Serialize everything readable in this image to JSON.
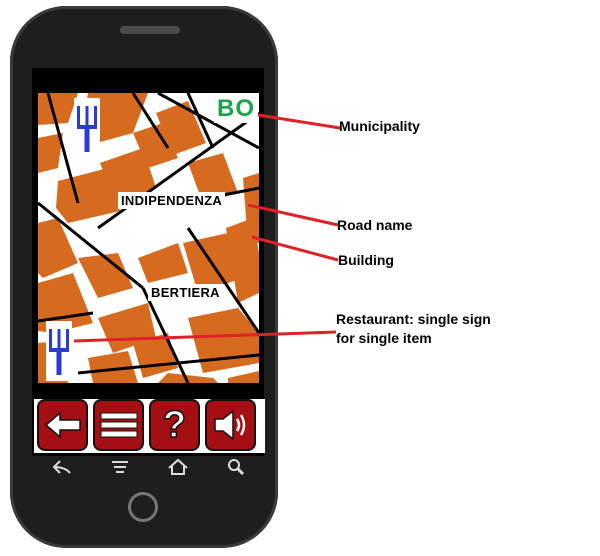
{
  "map": {
    "municipality": "BO",
    "road_name_1": "INDIPENDENZA",
    "road_name_2": "BERTIERA"
  },
  "toolbar": {
    "back": "back-arrow-icon",
    "menu": "menu-icon",
    "help": "?",
    "sound": "speaker-icon"
  },
  "navbar": {
    "back": "back-icon",
    "menu": "menu-icon",
    "home": "home-icon",
    "search": "search-icon"
  },
  "annotations": {
    "municipality": "Municipality",
    "road_name": "Road name",
    "building": "Building",
    "restaurant_line1": "Restaurant: single sign",
    "restaurant_line2": "for single item"
  },
  "colors": {
    "building": "#d66b1f",
    "municipality_text": "#1fa34a",
    "toolbar_button": "#a50f14",
    "callout_line": "#e0202a",
    "restaurant_icon": "#2b3bd6"
  }
}
